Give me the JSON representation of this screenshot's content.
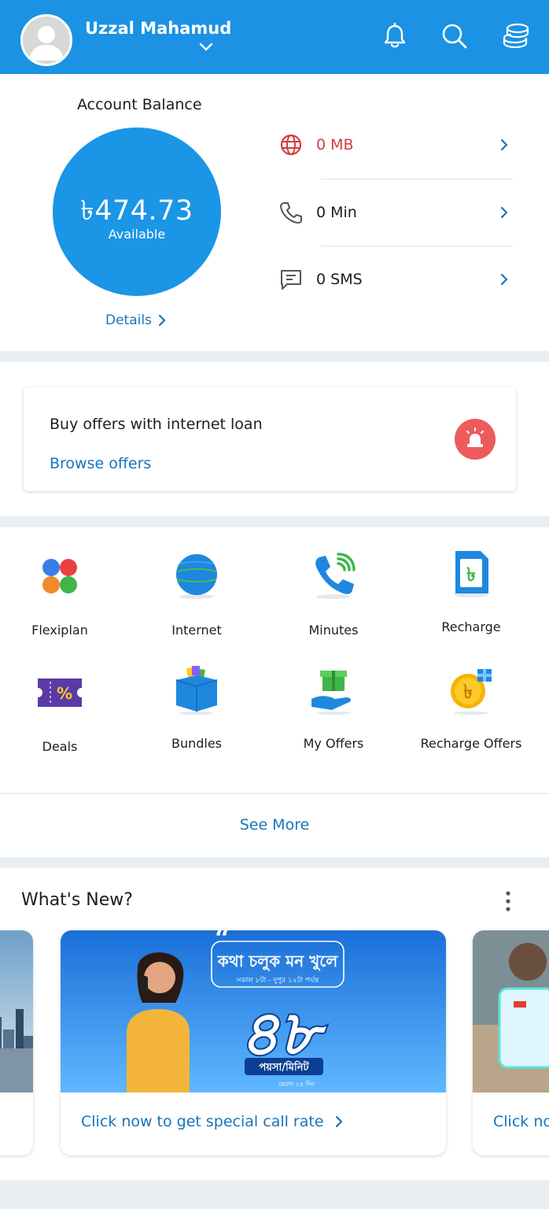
{
  "header": {
    "user_name": "Uzzal Mahamud",
    "brand_color": "#1b92e3",
    "icons": [
      "bell-icon",
      "search-icon",
      "coins-icon"
    ]
  },
  "balance": {
    "title": "Account Balance",
    "amount": "৳474.73",
    "sub": "Available",
    "details_label": "Details"
  },
  "usage": [
    {
      "icon": "globe-icon",
      "text": "0 MB",
      "color": "#d23c3c"
    },
    {
      "icon": "phone-icon",
      "text": "0 Min",
      "color": "#1d1d1d"
    },
    {
      "icon": "sms-icon",
      "text": "0 SMS",
      "color": "#1d1d1d"
    }
  ],
  "loan": {
    "title": "Buy offers with internet loan",
    "link": "Browse offers",
    "icon": "siren-icon"
  },
  "services": [
    {
      "label": "Flexiplan",
      "icon": "flexiplan-icon"
    },
    {
      "label": "Internet",
      "icon": "internet-globe-icon"
    },
    {
      "label": "Minutes",
      "icon": "minutes-phone-icon"
    },
    {
      "label": "Recharge",
      "icon": "recharge-sim-icon"
    },
    {
      "label": "Deals",
      "icon": "deals-ticket-icon"
    },
    {
      "label": "Bundles",
      "icon": "bundles-box-icon"
    },
    {
      "label": "My Offers",
      "icon": "gift-hand-icon"
    },
    {
      "label": "Recharge Offers",
      "icon": "taka-coin-icon"
    }
  ],
  "see_more": "See More",
  "news": {
    "title": "What's New?",
    "banners": [
      {
        "cta": ""
      },
      {
        "cta": "Click now to get special call rate",
        "headline": "কথা চলুক মন খুলে",
        "time_note": "সকাল ৮টা - দুপুর ১২টা পর্যন্ত",
        "rate": "৪৮",
        "unit": "পয়সা/মিনিট",
        "validity": "মেয়াদ ১৫ দিন"
      },
      {
        "cta": "Click no"
      }
    ]
  }
}
